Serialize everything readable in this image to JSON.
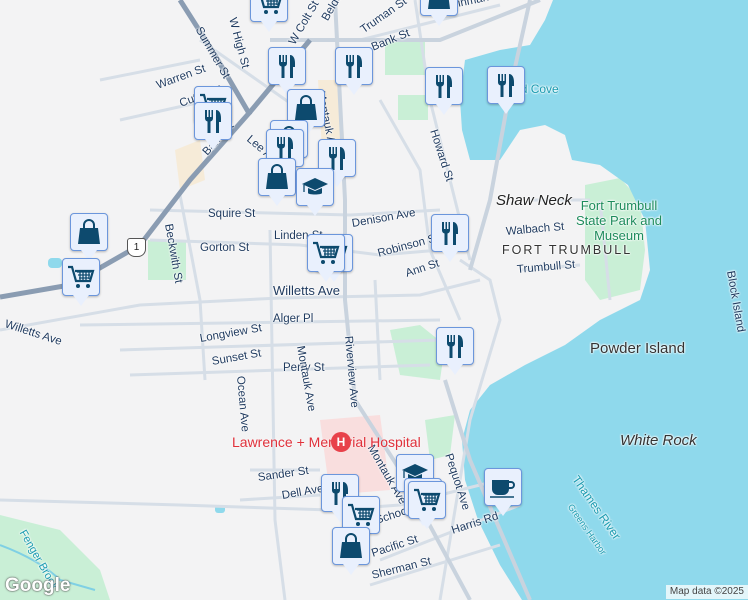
{
  "map": {
    "streets": [
      "Summer St",
      "W High St",
      "W Colt St",
      "Belden St",
      "Truman St",
      "Bank St",
      "Warren St",
      "Cutler St",
      "Bank St",
      "Lee Ave",
      "Montauk Ave",
      "Blinman St",
      "Howard St",
      "Squire St",
      "Denison Ave",
      "Beckwith St",
      "Gorton St",
      "Linden St",
      "Robinson St",
      "Ann St",
      "Walbach St",
      "Trumbull St",
      "Willetts Ave",
      "Willetts Ave",
      "Alger Pl",
      "Riverview Ave",
      "Longview St",
      "Sunset St",
      "Perry St",
      "Ocean Ave",
      "Montauk Ave",
      "Montauk Ave",
      "Pequot Ave",
      "Sander St",
      "Dell Ave",
      "School St",
      "Pacific St",
      "Harris Rd",
      "Sherman St",
      "Fenger Brook",
      "Block Island"
    ],
    "places": {
      "shaw_neck": "Shaw Neck",
      "fort_trumbull": "FORT TRUMBULL",
      "park": "Fort Trumbull State Park and Museum",
      "powder_island": "Powder Island",
      "white_rock": "White Rock",
      "shipyard_cove": "Shipyard Cove",
      "thames_river": "Thames River",
      "greens_harbor": "Greens Harbor",
      "hospital": "Lawrence + Memorial Hospital",
      "hospital_icon": "H",
      "route_shield": "1"
    },
    "markers": [
      "shopping-cart",
      "restaurant",
      "restaurant",
      "shopping-cart",
      "restaurant",
      "shopping-bag",
      "shopping-bag",
      "restaurant",
      "restaurant",
      "shopping-bag",
      "school",
      "restaurant",
      "restaurant",
      "shopping-bag",
      "shopping-bag",
      "shopping-cart",
      "restaurant",
      "shopping-cart",
      "shopping-cart",
      "restaurant",
      "school",
      "shopping-cart",
      "shopping-cart",
      "cafe",
      "restaurant",
      "shopping-cart",
      "shopping-bag"
    ],
    "colors": {
      "water": "#8fd9ec",
      "park": "#c9efd6",
      "hospital": "#f9dede",
      "road": "#d6dee7",
      "highway": "#8a9cb2",
      "icon": "#0d4a6e",
      "marker_bg": "#e9f0fd",
      "marker_border": "#6b96dc"
    }
  },
  "footer": {
    "logo": "Google",
    "attribution": "Map data ©2025"
  }
}
